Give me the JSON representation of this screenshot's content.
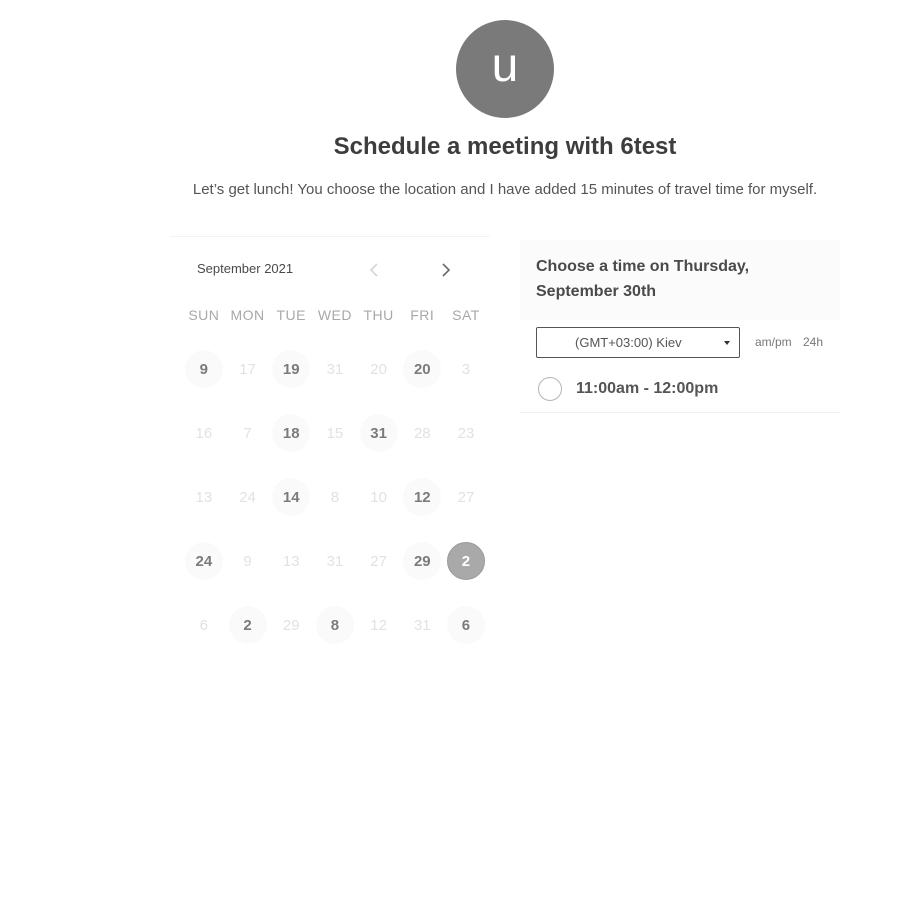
{
  "header": {
    "avatar_initial": "u",
    "title": "Schedule a meeting with 6test",
    "description": "Let’s get lunch! You choose the location and I have added 15 minutes of travel time for myself."
  },
  "calendar": {
    "month_label": "September 2021",
    "prev_icon": "chevron-left-icon",
    "next_icon": "chevron-right-icon",
    "weekdays": [
      "SUN",
      "MON",
      "TUE",
      "WED",
      "THU",
      "FRI",
      "SAT"
    ],
    "days": [
      {
        "label": "9",
        "state": "available"
      },
      {
        "label": "17",
        "state": "disabled"
      },
      {
        "label": "19",
        "state": "available"
      },
      {
        "label": "31",
        "state": "disabled"
      },
      {
        "label": "20",
        "state": "disabled"
      },
      {
        "label": "20",
        "state": "available"
      },
      {
        "label": "3",
        "state": "disabled"
      },
      {
        "label": "16",
        "state": "disabled"
      },
      {
        "label": "7",
        "state": "disabled"
      },
      {
        "label": "18",
        "state": "available"
      },
      {
        "label": "15",
        "state": "disabled"
      },
      {
        "label": "31",
        "state": "available"
      },
      {
        "label": "28",
        "state": "disabled"
      },
      {
        "label": "23",
        "state": "disabled"
      },
      {
        "label": "13",
        "state": "disabled"
      },
      {
        "label": "24",
        "state": "disabled"
      },
      {
        "label": "14",
        "state": "available"
      },
      {
        "label": "8",
        "state": "disabled"
      },
      {
        "label": "10",
        "state": "disabled"
      },
      {
        "label": "12",
        "state": "available"
      },
      {
        "label": "27",
        "state": "disabled"
      },
      {
        "label": "24",
        "state": "available"
      },
      {
        "label": "9",
        "state": "disabled"
      },
      {
        "label": "13",
        "state": "disabled"
      },
      {
        "label": "31",
        "state": "disabled"
      },
      {
        "label": "27",
        "state": "disabled"
      },
      {
        "label": "29",
        "state": "available"
      },
      {
        "label": "2",
        "state": "selected"
      },
      {
        "label": "6",
        "state": "disabled"
      },
      {
        "label": "2",
        "state": "available"
      },
      {
        "label": "29",
        "state": "disabled"
      },
      {
        "label": "8",
        "state": "available"
      },
      {
        "label": "12",
        "state": "disabled"
      },
      {
        "label": "31",
        "state": "disabled"
      },
      {
        "label": "6",
        "state": "available"
      }
    ]
  },
  "time_panel": {
    "heading": "Choose a time on Thursday, September 30th",
    "timezone": "(GMT+03:00) Kiev",
    "format_ampm": "am/pm",
    "format_24h": "24h",
    "slots": [
      {
        "label": "11:00am - 12:00pm"
      }
    ]
  }
}
